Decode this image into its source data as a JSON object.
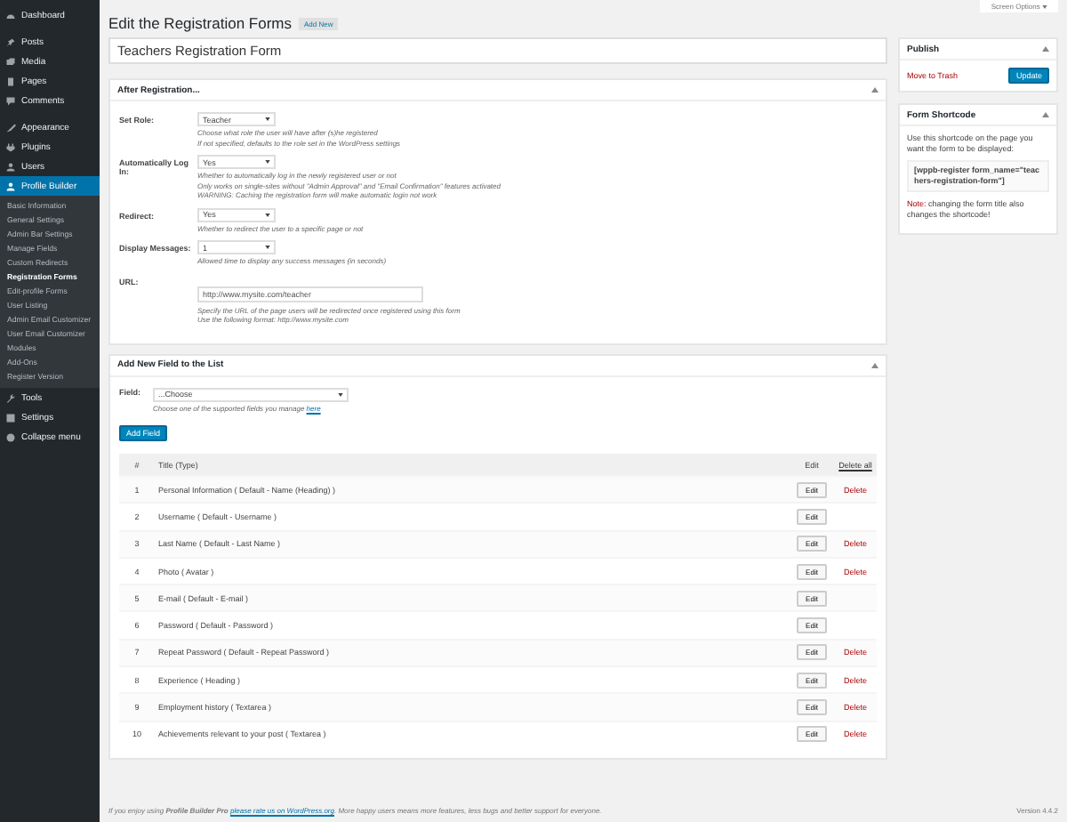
{
  "screen_options": "Screen Options",
  "menu": [
    {
      "items": [
        {
          "label": "Dashboard",
          "selected": false
        }
      ]
    },
    {
      "items": [
        {
          "label": "Posts",
          "selected": false
        },
        {
          "label": "Media",
          "selected": false
        },
        {
          "label": "Pages",
          "selected": false
        },
        {
          "label": "Comments",
          "selected": false
        }
      ]
    },
    {
      "items": [
        {
          "label": "Appearance",
          "selected": false
        },
        {
          "label": "Plugins",
          "selected": false
        },
        {
          "label": "Users",
          "selected": false
        },
        {
          "label": "Profile Builder",
          "selected": true,
          "children": [
            {
              "label": "Basic Information",
              "selected": false
            },
            {
              "label": "General Settings",
              "selected": false
            },
            {
              "label": "Admin Bar Settings",
              "selected": false
            },
            {
              "label": "Manage Fields",
              "selected": false
            },
            {
              "label": "Custom Redirects",
              "selected": false
            },
            {
              "label": "Registration Forms",
              "selected": true
            },
            {
              "label": "Edit-profile Forms",
              "selected": false
            },
            {
              "label": "User Listing",
              "selected": false
            },
            {
              "label": "Admin Email Customizer",
              "selected": false
            },
            {
              "label": "User Email Customizer",
              "selected": false
            },
            {
              "label": "Modules",
              "selected": false
            },
            {
              "label": "Add-Ons",
              "selected": false
            },
            {
              "label": "Register Version",
              "selected": false
            }
          ]
        },
        {
          "label": "Tools",
          "selected": false
        },
        {
          "label": "Settings",
          "selected": false
        },
        {
          "label": "Collapse menu",
          "selected": false
        }
      ]
    }
  ],
  "page_title": "Edit the Registration Forms",
  "add_new": "Add New",
  "form_title": "Teachers Registration Form",
  "after_registration": {
    "heading": "After Registration...",
    "settings": [
      {
        "label": "Set Role:",
        "kind": "select",
        "value": "Teacher",
        "help": [
          "Choose what role the user will have after (s)he registered",
          "If not specified, defaults to the role set in the WordPress settings"
        ]
      },
      {
        "label": "Automatically Log In:",
        "kind": "select",
        "value": "Yes",
        "help": [
          "Whether to automatically log in the newly registered user or not",
          "Only works on single-sites without \"Admin Approval\" and \"Email Confirmation\" features activated",
          "WARNING: Caching the registration form will make automatic login not work"
        ]
      },
      {
        "label": "Redirect:",
        "kind": "select",
        "value": "Yes",
        "help": [
          "Whether to redirect the user to a specific page or not"
        ]
      },
      {
        "label": "Display Messages:",
        "kind": "select",
        "value": "1",
        "help": [
          "Allowed time to display any success messages (in seconds)"
        ]
      },
      {
        "label": "URL:",
        "kind": "text",
        "value": "http://www.mysite.com/teacher",
        "help": [
          "Specify the URL of the page users will be redirected once registered using this form",
          "Use the following format: http://www.mysite.com"
        ]
      }
    ]
  },
  "add_field": {
    "heading": "Add New Field to the List",
    "field_label": "Field:",
    "field_value": "...Choose",
    "help": "Choose one of the supported fields you manage",
    "help_link": "here",
    "button": "Add Field"
  },
  "table": {
    "columns": [
      "#",
      "Title (Type)",
      "Edit",
      "Delete all"
    ],
    "rows": [
      {
        "num": "1",
        "title": "Personal Information ( Default - Name (Heading) )",
        "edit": "Edit",
        "delete": "Delete"
      },
      {
        "num": "2",
        "title": "Username ( Default - Username )",
        "edit": "Edit"
      },
      {
        "num": "3",
        "title": "Last Name ( Default - Last Name )",
        "edit": "Edit",
        "delete": "Delete"
      },
      {
        "num": "4",
        "title": "Photo ( Avatar )",
        "edit": "Edit",
        "delete": "Delete"
      },
      {
        "num": "5",
        "title": "E-mail ( Default - E-mail )",
        "edit": "Edit"
      },
      {
        "num": "6",
        "title": "Password ( Default - Password )",
        "edit": "Edit"
      },
      {
        "num": "7",
        "title": "Repeat Password ( Default - Repeat Password )",
        "edit": "Edit",
        "delete": "Delete"
      },
      {
        "num": "8",
        "title": "Experience ( Heading )",
        "edit": "Edit",
        "delete": "Delete"
      },
      {
        "num": "9",
        "title": "Employment history ( Textarea )",
        "edit": "Edit",
        "delete": "Delete"
      },
      {
        "num": "10",
        "title": "Achievements relevant to your post ( Textarea )",
        "edit": "Edit",
        "delete": "Delete"
      }
    ]
  },
  "publish": {
    "heading": "Publish",
    "trash": "Move to Trash",
    "button": "Update"
  },
  "shortcode": {
    "heading": "Form Shortcode",
    "intro": "Use this shortcode on the page you want the form to be displayed:",
    "code": "[wppb-register form_name=\"teachers-registration-form\"]",
    "note_label": "Note:",
    "note": "changing the form title also changes the shortcode!"
  },
  "footer": {
    "before": "If you enjoy using ",
    "product": "Profile Builder Pro",
    "link": "please rate us on WordPress.org",
    "after": ". More happy users means more features, less bugs and better support for everyone.",
    "version": "Version 4.4.2"
  }
}
